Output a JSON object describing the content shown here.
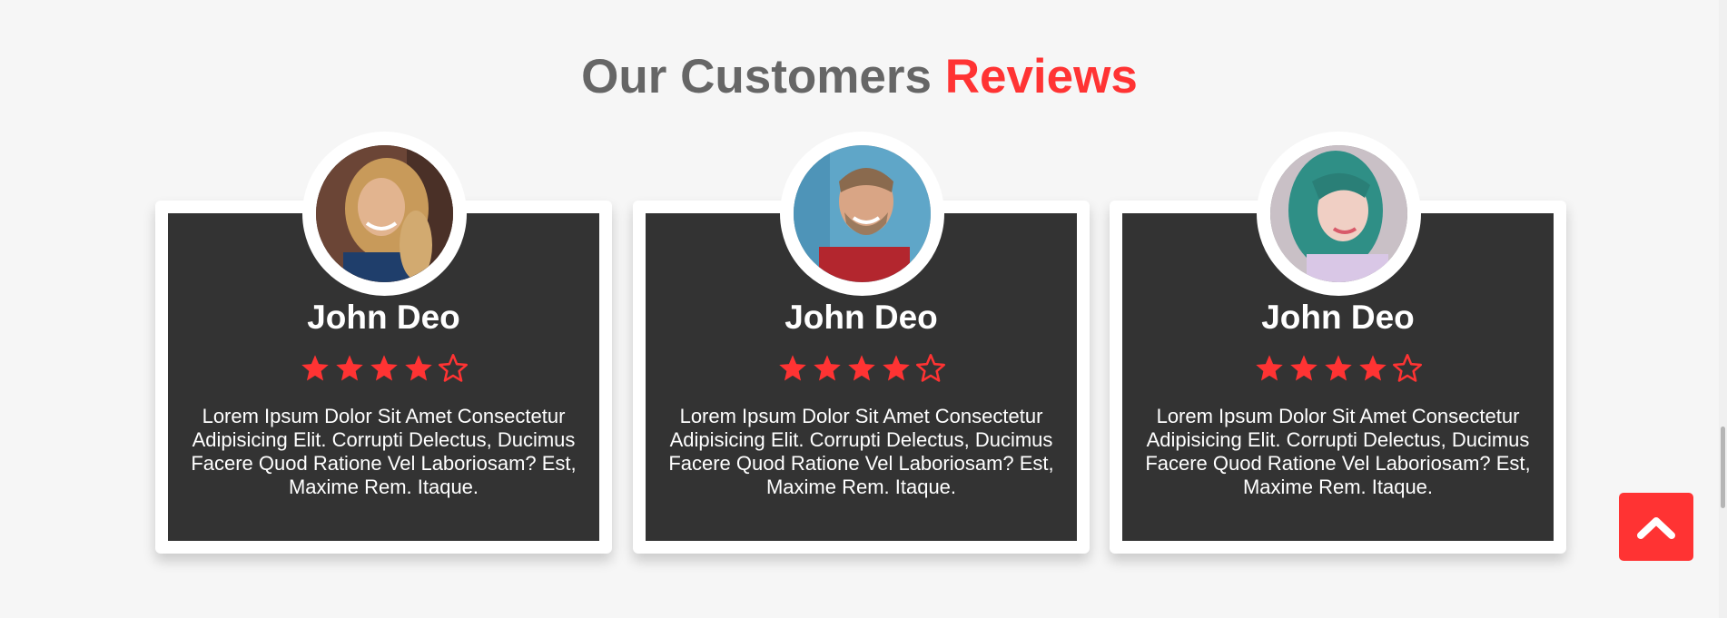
{
  "section": {
    "title_main": "Our Customers",
    "title_accent": "Reviews"
  },
  "colors": {
    "accent": "#ff3333",
    "card_bg": "#333333",
    "page_bg": "#f6f6f6",
    "heading": "#666666"
  },
  "reviews": [
    {
      "name": "John Deo",
      "rating": 4,
      "max_rating": 5,
      "text": "Lorem Ipsum Dolor Sit Amet Consectetur Adipisicing Elit. Corrupti Delectus, Ducimus Facere Quod Ratione Vel Laboriosam? Est, Maxime Rem. Itaque."
    },
    {
      "name": "John Deo",
      "rating": 4,
      "max_rating": 5,
      "text": "Lorem Ipsum Dolor Sit Amet Consectetur Adipisicing Elit. Corrupti Delectus, Ducimus Facere Quod Ratione Vel Laboriosam? Est, Maxime Rem. Itaque."
    },
    {
      "name": "John Deo",
      "rating": 4,
      "max_rating": 5,
      "text": "Lorem Ipsum Dolor Sit Amet Consectetur Adipisicing Elit. Corrupti Delectus, Ducimus Facere Quod Ratione Vel Laboriosam? Est, Maxime Rem. Itaque."
    }
  ],
  "icons": {
    "star_filled": "star-filled-icon",
    "star_empty": "star-outline-icon",
    "scroll_top": "chevron-up-icon"
  }
}
